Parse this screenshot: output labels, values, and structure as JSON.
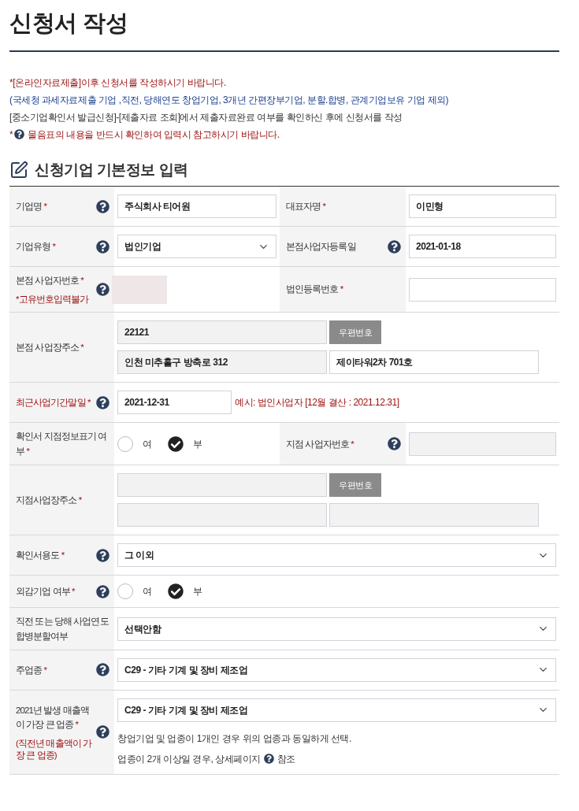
{
  "page_title": "신청서 작성",
  "notices": [
    {
      "kind": "red",
      "text": "*[온라인자료제출]이후 신청서를 작성하시기 바랍니다."
    },
    {
      "kind": "blue",
      "text": "(국세청 과세자료제출 기업 ,직전, 당해연도 창업기업, 3개년 간편장부기업, 분할.합병, 관계기업보유 기업 제외)"
    },
    {
      "kind": "plain",
      "text": "[중소기업확인서 발급신청]-[제출자료 조회]에서 제출자료완료 여부를 확인하신 후에 신청서를 작성"
    },
    {
      "kind": "help",
      "prefix": "*",
      "text": "물음표의 내용을 반드시 확인하여 입력시 참고하시기 바랍니다."
    }
  ],
  "section_title": "신청기업 기본정보 입력",
  "rows": [
    {
      "fields": [
        {
          "label": "기업명",
          "required_mark": "*",
          "help": true,
          "control": {
            "kind": "text",
            "value": "주식회사 티어원",
            "disabled": false
          }
        },
        {
          "label": "대표자명",
          "required_mark": "*",
          "help": false,
          "control": {
            "kind": "text",
            "value": "이민형",
            "disabled": false
          }
        }
      ]
    },
    {
      "fields": [
        {
          "label": "기업유형",
          "required_mark": "*",
          "help": true,
          "control": {
            "kind": "select",
            "value": "법인기업"
          }
        },
        {
          "label": "본점사업자등록일",
          "help": true,
          "control": {
            "kind": "text",
            "value": "2021-01-18",
            "disabled": false
          }
        }
      ]
    },
    {
      "fields": [
        {
          "label": "본점 사업자번호",
          "required_mark": "*",
          "help": true,
          "note": "*고유번호입력불가",
          "control": {
            "kind": "masked"
          }
        },
        {
          "label": "법인등록번호",
          "required_mark": "*",
          "help": false,
          "control": {
            "kind": "text",
            "disabled": false
          }
        }
      ]
    },
    {
      "fields": [
        {
          "label": "본점 사업장주소",
          "required_mark": "*",
          "help": false,
          "control": {
            "kind": "address",
            "zip": {
              "value": "22121",
              "disabled": true
            },
            "button": "우편번호",
            "address1": {
              "value": "인천 미추홀구 방축로 312",
              "disabled": true
            },
            "address2": {
              "value": "제이타워2차 701호",
              "disabled": false
            }
          }
        }
      ]
    },
    {
      "fields": [
        {
          "label": "최근사업기간말일",
          "required_mark": "*",
          "emphasis": true,
          "help": true,
          "control": {
            "kind": "date_hint",
            "value": "2021-12-31",
            "hint": "예시: 법인사업자 [12월 결산 : 2021.12.31]"
          }
        }
      ]
    },
    {
      "fields": [
        {
          "label": "확인서 지점정보표기 여부",
          "required_mark": "*",
          "help": false,
          "control": {
            "kind": "radio",
            "options": [
              {
                "label": "여",
                "selected": false
              },
              {
                "label": "부",
                "selected": true
              }
            ]
          }
        },
        {
          "label": "지점 사업자번호",
          "required_mark": "*",
          "help": true,
          "control": {
            "kind": "text",
            "disabled": true
          }
        }
      ]
    },
    {
      "fields": [
        {
          "label": "지점사업장주소",
          "required_mark": "*",
          "help": false,
          "control": {
            "kind": "address",
            "zip": {
              "disabled": true
            },
            "button": "우편번호",
            "address1": {
              "disabled": true
            },
            "address2": {
              "disabled": true
            }
          }
        }
      ]
    },
    {
      "fields": [
        {
          "label": "확인서용도",
          "required_mark": "*",
          "help": true,
          "control": {
            "kind": "select",
            "value": "그 이외"
          }
        }
      ]
    },
    {
      "fields": [
        {
          "label": "외감기업 여부",
          "required_mark": "*",
          "help": true,
          "control": {
            "kind": "radio",
            "options": [
              {
                "label": "여",
                "selected": false
              },
              {
                "label": "부",
                "selected": true
              }
            ]
          }
        }
      ]
    },
    {
      "fields": [
        {
          "label": "직전 또는 당해 사업연도 합병분할여부",
          "help": false,
          "control": {
            "kind": "select",
            "value": "선택안함"
          }
        }
      ]
    },
    {
      "fields": [
        {
          "label": "주업종",
          "required_mark": "*",
          "help": true,
          "control": {
            "kind": "select",
            "value": "C29 - 기타 기계 및 장비 제조업"
          }
        }
      ]
    },
    {
      "fields": [
        {
          "label": "2021년 발생 매출액이 가장 큰 업종",
          "required_mark": "*",
          "help": true,
          "note": "(직전년 매출액이 가장 큰 업종)",
          "control": {
            "kind": "select",
            "value": "C29 - 기타 기계 및 장비 제조업",
            "hints": [
              {
                "text": "창업기업 및 업종이 1개인 경우 위의 업종과 동일하게 선택."
              },
              {
                "text": "업종이 2개 이상일 경우, 상세페이지",
                "after_icon": "참조"
              }
            ]
          }
        }
      ]
    }
  ]
}
